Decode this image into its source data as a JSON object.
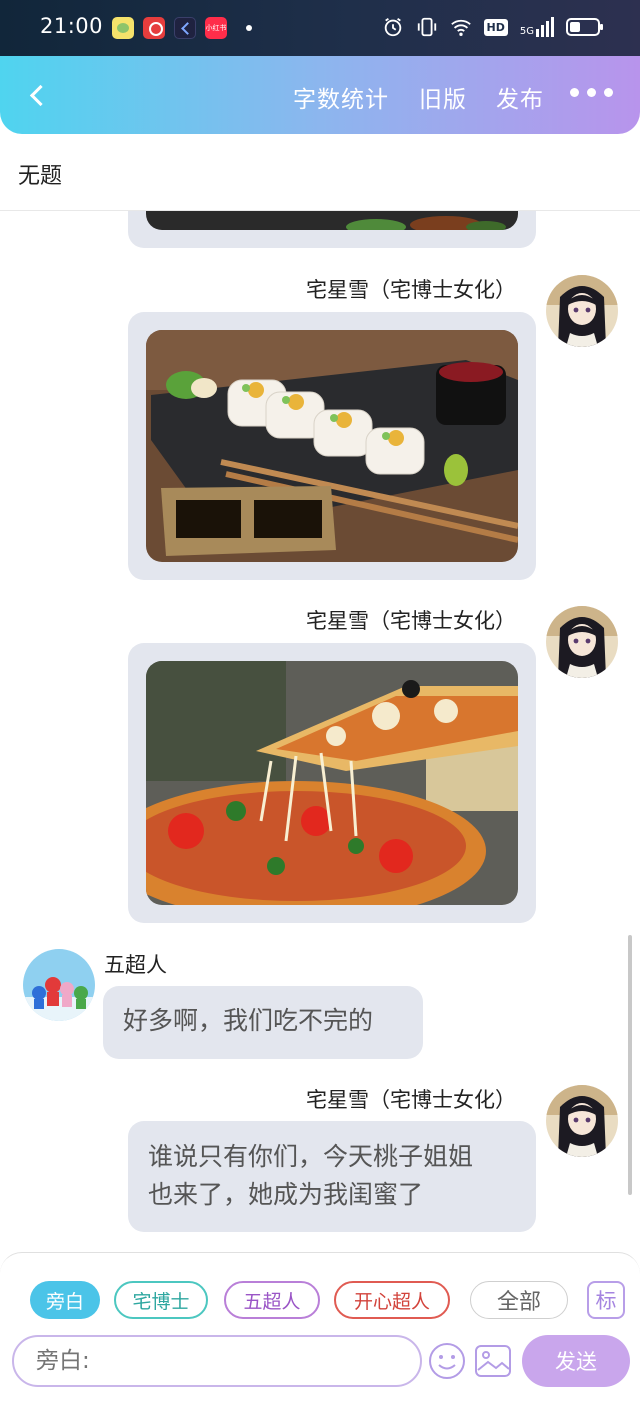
{
  "status_bar": {
    "time": "21:00",
    "app_icons": [
      "meituan-icon",
      "netease-music-icon",
      "kuaishou-icon",
      "xiaohongshu-icon"
    ],
    "xiaohongshu_label": "小红书",
    "indicators": [
      "alarm-icon",
      "vibrate-icon",
      "wifi-icon",
      "hd-icon",
      "5g-signal-icon",
      "battery-icon"
    ],
    "hd_label": "HD",
    "network_label": "5G"
  },
  "header": {
    "word_count": "字数统计",
    "old_version": "旧版",
    "publish": "发布",
    "gradient_start": "#4fd4ef",
    "gradient_end": "#b894ec"
  },
  "document": {
    "title": "无题"
  },
  "messages": [
    {
      "type": "image",
      "sender": "",
      "side": "right",
      "image": "food-photo-partial"
    },
    {
      "type": "image",
      "sender": "宅星雪（宅博士女化）",
      "side": "right",
      "image": "sushi-photo"
    },
    {
      "type": "image",
      "sender": "宅星雪（宅博士女化）",
      "side": "right",
      "image": "pizza-photo"
    },
    {
      "type": "text",
      "sender": "五超人",
      "side": "left",
      "text": "好多啊，我们吃不完的"
    },
    {
      "type": "text",
      "sender": "宅星雪（宅博士女化）",
      "side": "right",
      "text_lines": [
        "谁说只有你们，今天桃子姐姐",
        "也来了，她成为我闺蜜了"
      ]
    }
  ],
  "roles": {
    "narration": "旁白",
    "doctor": "宅博士",
    "five": "五超人",
    "happy": "开心超人",
    "all": "全部",
    "mark": "标"
  },
  "composer": {
    "placeholder": "旁白:",
    "send": "发送"
  },
  "colors": {
    "bubble": "#e3e6ee",
    "narration_chip": "#4bc4e8",
    "send_button": "#c9a6ec"
  }
}
